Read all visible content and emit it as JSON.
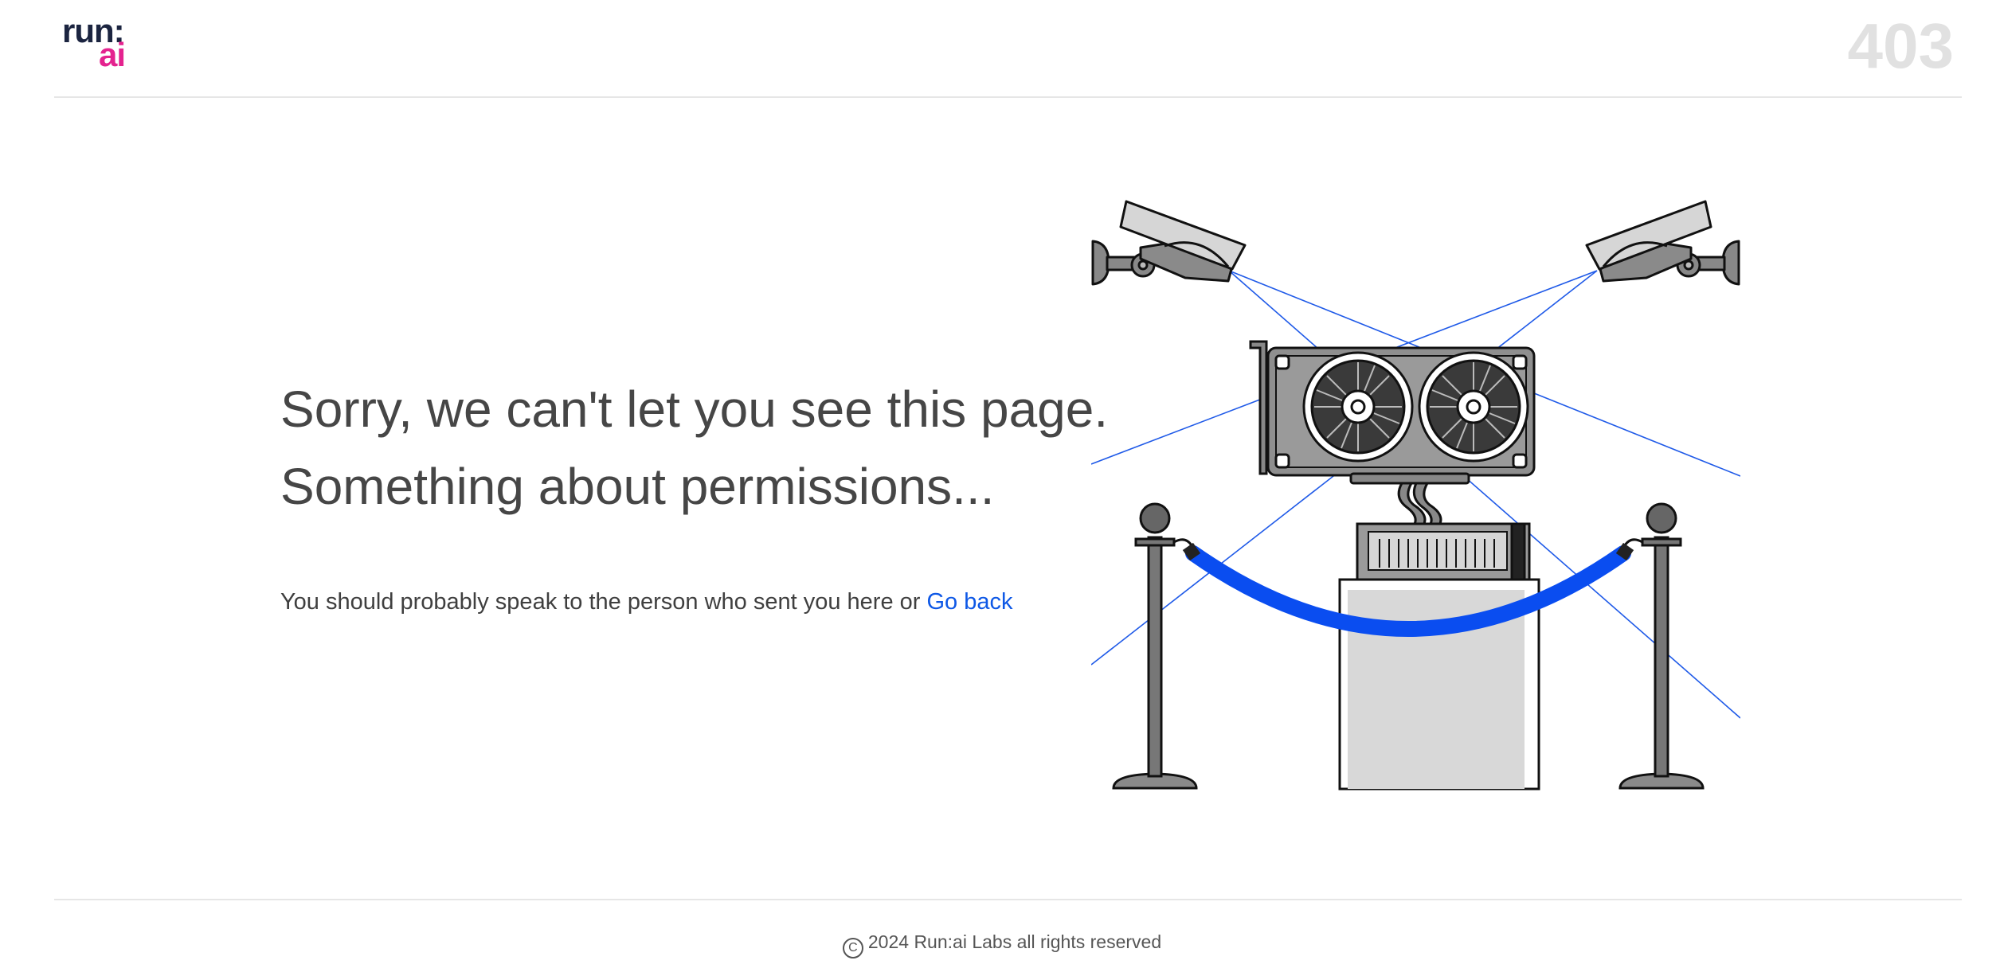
{
  "header": {
    "logo_run": "run:",
    "logo_ai": "ai",
    "error_code": "403"
  },
  "main": {
    "headline_line1": "Sorry, we can't let you see this page.",
    "headline_line2": "Something about permissions...",
    "message": "You should probably speak to the person who sent you here or",
    "go_back_label": "Go back"
  },
  "footer": {
    "copyright_symbol": "C",
    "copyright_text": "2024 Run:ai Labs all rights reserved"
  },
  "colors": {
    "brand_dark": "#1b2440",
    "brand_pink": "#e4238f",
    "link": "#0e58e6",
    "rope": "#0a4df0",
    "laser": "#1f5ae8"
  },
  "illustration": {
    "name": "gpu-behind-velvet-rope-with-security-cameras"
  }
}
